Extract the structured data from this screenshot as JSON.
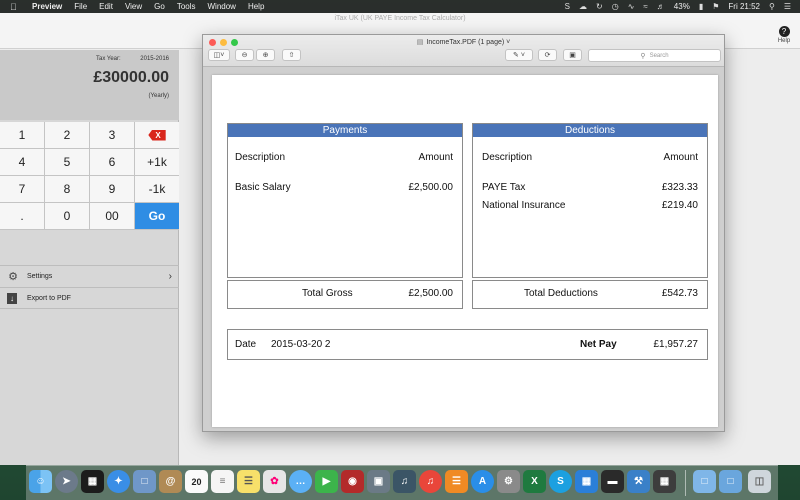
{
  "menubar": {
    "apple_icon": "apple-logo",
    "items": [
      "Preview",
      "File",
      "Edit",
      "View",
      "Go",
      "Tools",
      "Window",
      "Help"
    ],
    "battery": "43%",
    "clock": "Fri 21:52"
  },
  "itax": {
    "title": "iTax UK (UK PAYE Income Tax Calculator)",
    "help_label": "Help",
    "tax_year_label": "Tax Year:",
    "tax_year": "2015-2016",
    "amount": "£30000.00",
    "period": "(Yearly)",
    "keys": [
      "1",
      "2",
      "3",
      "X",
      "4",
      "5",
      "6",
      "+1k",
      "7",
      "8",
      "9",
      "-1k",
      ".",
      "0",
      "00",
      "Go"
    ],
    "menu": {
      "settings": "Settings",
      "export": "Export to PDF"
    }
  },
  "preview": {
    "title": "IncomeTax.PDF (1 page)",
    "search_placeholder": "Search",
    "payments": {
      "header": "Payments",
      "col_desc": "Description",
      "col_amount": "Amount",
      "rows": [
        {
          "desc": "Basic Salary",
          "amount": "£2,500.00"
        }
      ],
      "total_label": "Total Gross",
      "total": "£2,500.00"
    },
    "deductions": {
      "header": "Deductions",
      "col_desc": "Description",
      "col_amount": "Amount",
      "rows": [
        {
          "desc": "PAYE Tax",
          "amount": "£323.33"
        },
        {
          "desc": "National Insurance",
          "amount": "£219.40"
        }
      ],
      "total_label": "Total Deductions",
      "total": "£542.73"
    },
    "footer": {
      "date_label": "Date",
      "date": "2015-03-20 2",
      "net_label": "Net Pay",
      "net": "£1,957.27"
    }
  },
  "dock": {
    "calendar_day": "20",
    "apps": [
      "finder-icon",
      "launchpad-icon",
      "dashboard-icon",
      "safari-icon",
      "preview-icon",
      "contacts-icon",
      "calendar-icon",
      "reminders-icon",
      "notes-icon",
      "photos-icon",
      "messages-icon",
      "facetime-icon",
      "photo-booth-icon",
      "image-capture-icon",
      "itunes-icon",
      "ibooks-icon",
      "app-store-icon",
      "system-preferences-icon",
      "excel-icon",
      "skype-icon",
      "keynote-icon",
      "wallet-icon",
      "xcode-icon",
      "crossover-icon",
      "folder-icon",
      "downloads-icon",
      "trash-icon"
    ]
  }
}
